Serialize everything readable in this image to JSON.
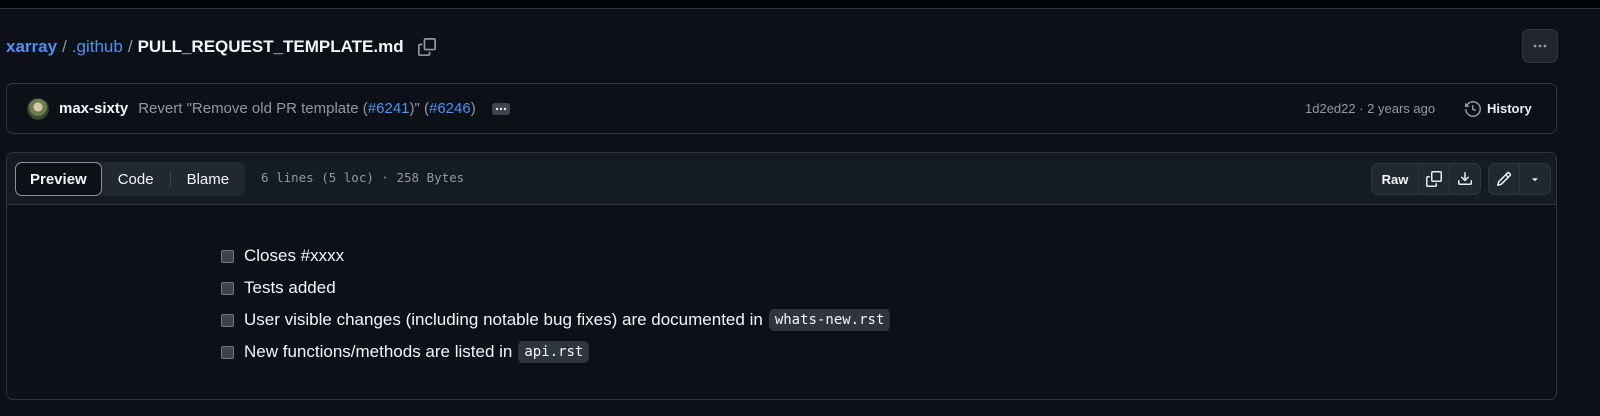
{
  "breadcrumb": {
    "repo": "xarray",
    "folder": ".github",
    "file": "PULL_REQUEST_TEMPLATE.md",
    "sep1": "/",
    "sep2": "/"
  },
  "commit": {
    "author": "max-sixty",
    "message_prefix": "Revert \"Remove old PR template (",
    "pr_ref_1": "#6241",
    "message_mid": ")\" (",
    "pr_ref_2": "#6246",
    "message_suffix": ")",
    "sha_time": "1d2ed22 · 2 years ago",
    "history_label": "History"
  },
  "file_header": {
    "tabs": [
      {
        "label": "Preview",
        "active": true
      },
      {
        "label": "Code",
        "active": false
      },
      {
        "label": "Blame",
        "active": false
      }
    ],
    "meta": "6 lines (5 loc) · 258 Bytes",
    "raw_label": "Raw"
  },
  "checklist": [
    {
      "text": "Closes #xxxx",
      "code": ""
    },
    {
      "text": "Tests added",
      "code": ""
    },
    {
      "text": "User visible changes (including notable bug fixes) are documented in",
      "code": "whats-new.rst"
    },
    {
      "text": "New functions/methods are listed in",
      "code": "api.rst"
    }
  ],
  "colors": {
    "background": "#0d1117",
    "link": "#4493f8",
    "border": "#30363d",
    "muted": "#9198a1"
  }
}
